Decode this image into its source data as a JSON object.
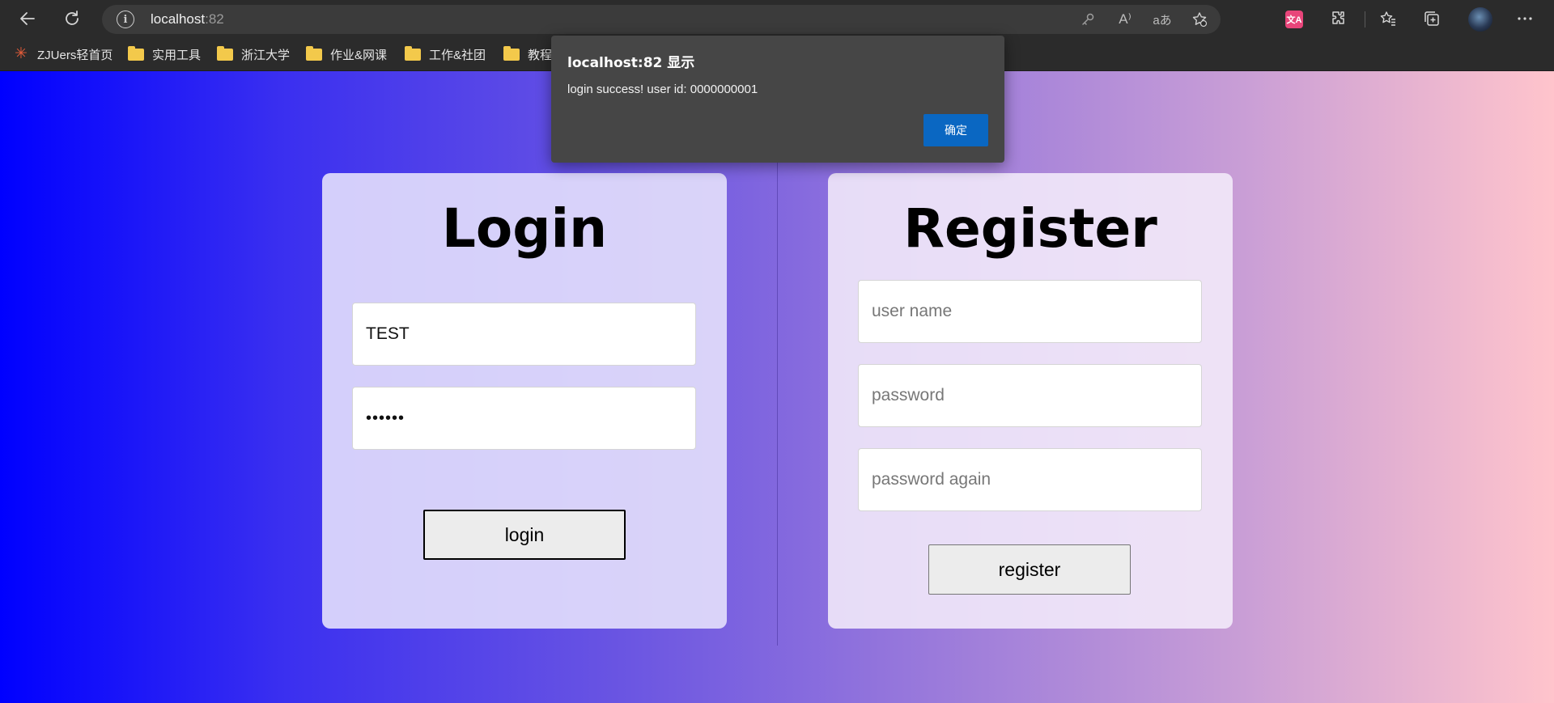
{
  "browser": {
    "url_host": "localhost",
    "url_port": ":82",
    "icons": {
      "back": "back-arrow-icon",
      "refresh": "refresh-icon",
      "site_info": "info-icon",
      "password_key": "key-icon",
      "read_aloud": "read-aloud-icon",
      "translate_page": "translate-icon",
      "add_favorite": "add-favorite-icon",
      "extensions": "puzzle-icon",
      "favorites": "favorites-icon",
      "collections": "collections-icon",
      "more": "more-icon"
    },
    "translate_ext_text": "文A",
    "site_info_glyph": "i",
    "read_aloud_glyph": "A⁾",
    "translate_glyph": "aあ"
  },
  "bookmarks": [
    {
      "label": "ZJUers轻首页",
      "icon": "zju-logo-icon"
    },
    {
      "label": "实用工具",
      "icon": "folder-icon"
    },
    {
      "label": "浙江大学",
      "icon": "folder-icon"
    },
    {
      "label": "作业&网课",
      "icon": "folder-icon"
    },
    {
      "label": "工作&社团",
      "icon": "folder-icon"
    },
    {
      "label": "教程",
      "icon": "folder-icon"
    }
  ],
  "dialog": {
    "title": "localhost:82 显示",
    "message": "login success! user id: 0000000001",
    "ok_label": "确定"
  },
  "login": {
    "title": "Login",
    "username_value": "TEST",
    "password_value": "••••••",
    "button_label": "login"
  },
  "register": {
    "title": "Register",
    "username_placeholder": "user name",
    "password_placeholder": "password",
    "password_again_placeholder": "password again",
    "button_label": "register"
  },
  "colors": {
    "gradient_start": "#0000ff",
    "gradient_end": "#ffc4cc",
    "dialog_bg": "#464646",
    "ok_button": "#0a67c2"
  }
}
